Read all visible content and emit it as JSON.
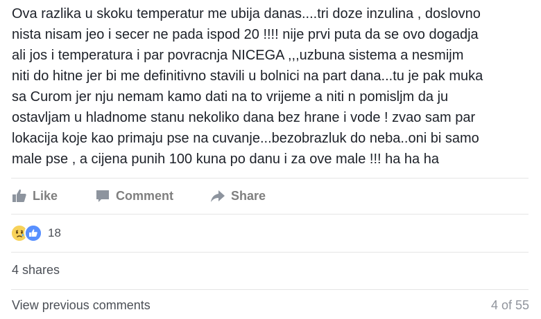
{
  "post": {
    "text": "Ova razlika u skoku temperatur me ubija danas....tri doze inzulina , doslovno\nnista nisam jeo i secer ne pada ispod 20 !!!! nije prvi puta da se ovo dogadja\nali jos i temperatura i par povracnja NICEGA ,,,uzbuna sistema a nesmijm\nniti do hitne jer bi me definitivno stavili u bolnici na part dana...tu je pak muka\nsa Curom jer nju nemam kamo dati na to vrijeme a niti n pomisljm da ju\nostavljam u hladnome stanu nekoliko dana bez hrane i vode ! zvao sam par\nlokacija koje kao primaju pse na cuvanje...bezobrazluk do neba..oni bi samo\nmale pse , a cijena punih 100 kuna po danu i za ove male !!! ha ha ha"
  },
  "actions": {
    "like_label": "Like",
    "comment_label": "Comment",
    "share_label": "Share"
  },
  "reactions": {
    "icons": [
      "sad-icon",
      "like-icon"
    ],
    "count": "18"
  },
  "shares": {
    "label": "4 shares"
  },
  "comments": {
    "view_previous_label": "View previous comments",
    "pager": "4 of 55"
  },
  "colors": {
    "text": "#1d2129",
    "action_gray": "#7f7f7f",
    "like_blue": "#5890ff",
    "sad_yellow": "#f7d25a",
    "divider": "#e5e5e5"
  }
}
